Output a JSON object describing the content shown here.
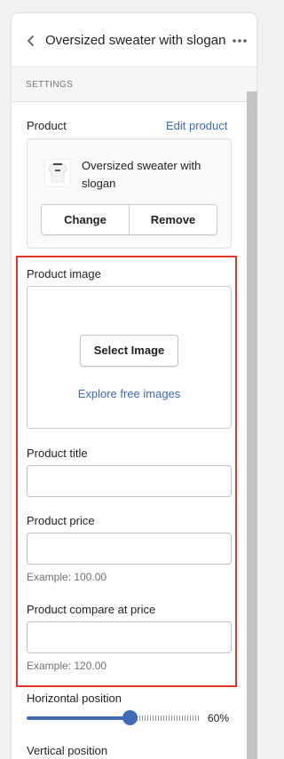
{
  "header": {
    "title": "Oversized sweater with slogan",
    "back_icon": "chevron-left-icon",
    "more_icon": "horizontal-dots-icon"
  },
  "section": {
    "title": "SETTINGS"
  },
  "product": {
    "label": "Product",
    "edit_link": "Edit product",
    "name": "Oversized sweater with slogan",
    "change_label": "Change",
    "remove_label": "Remove"
  },
  "product_image": {
    "label": "Product image",
    "select_button": "Select Image",
    "explore_link": "Explore free images"
  },
  "product_title": {
    "label": "Product title",
    "value": ""
  },
  "product_price": {
    "label": "Product price",
    "value": "",
    "help": "Example: 100.00"
  },
  "product_compare_price": {
    "label": "Product compare at price",
    "value": "",
    "help": "Example: 120.00"
  },
  "horizontal_position": {
    "label": "Horizontal position",
    "value_percent": 60,
    "display": "60%"
  },
  "vertical_position": {
    "label": "Vertical position"
  },
  "colors": {
    "accent": "#3e6ab7",
    "highlight": "#e0362b"
  }
}
